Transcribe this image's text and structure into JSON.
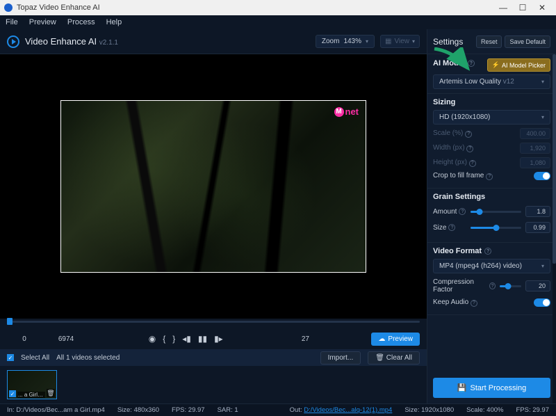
{
  "window": {
    "title": "Topaz Video Enhance AI"
  },
  "menu": {
    "file": "File",
    "preview": "Preview",
    "process": "Process",
    "help": "Help"
  },
  "app": {
    "name": "Video Enhance AI",
    "version": "v2.1.1"
  },
  "zoom": {
    "label": "Zoom",
    "value": "143%"
  },
  "view": {
    "label": "View"
  },
  "watermark": {
    "m": "M",
    "net": "net"
  },
  "transport": {
    "start": "0",
    "total": "6974",
    "current": "27",
    "preview": "Preview"
  },
  "selection": {
    "select_all": "Select All",
    "count": "All 1 videos selected",
    "import": "Import...",
    "clear_all": "Clear All"
  },
  "thumb": {
    "name": "... a Girl.mp4"
  },
  "status": {
    "in_label": "In:",
    "in_path": "D:/Videos/Bec...am a Girl.mp4",
    "in_size": "Size: 480x360",
    "in_fps": "FPS: 29.97",
    "in_sar": "SAR: 1",
    "out_label": "Out:",
    "out_path": "D:/Videos/Bec...alq-12(1).mp4",
    "out_size": "Size: 1920x1080",
    "out_scale": "Scale: 400%",
    "out_fps": "FPS: 29.97"
  },
  "settings": {
    "title": "Settings",
    "reset": "Reset",
    "save_default": "Save Default",
    "ai_model": {
      "label": "AI Model",
      "picker": "AI Model Picker",
      "value": "Artemis Low Quality",
      "ver": "v12"
    },
    "sizing": {
      "label": "Sizing",
      "preset": "HD (1920x1080)",
      "scale_label": "Scale (%)",
      "scale": "400.00",
      "width_label": "Width (px)",
      "width": "1,920",
      "height_label": "Height (px)",
      "height": "1,080",
      "crop_label": "Crop to fill frame"
    },
    "grain": {
      "label": "Grain Settings",
      "amount_label": "Amount",
      "amount": "1.8",
      "size_label": "Size",
      "size": "0.99"
    },
    "format": {
      "label": "Video Format",
      "codec": "MP4 (mpeg4 (h264) video)",
      "compression_label": "Compression Factor",
      "compression": "20",
      "keep_audio_label": "Keep Audio"
    },
    "start": "Start Processing"
  }
}
